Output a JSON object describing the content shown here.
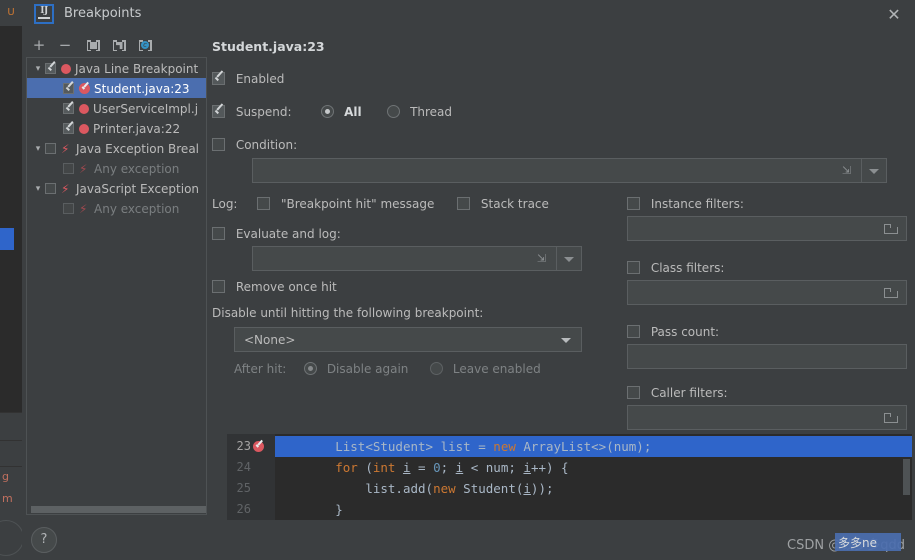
{
  "background": {
    "tab_letter": "U",
    "marker_g": "g",
    "marker_m": "m"
  },
  "window": {
    "title": "Breakpoints",
    "logo_text": "IJ",
    "close_label": "✕"
  },
  "toolbar": {
    "add_label": "+",
    "remove_label": "−",
    "group_icon": "move-to-group-icon",
    "set_icon": "edit-group-icon",
    "mute_icon": "mute-breakpoints-icon"
  },
  "tree": {
    "items": [
      {
        "label": "Java Line Breakpoint",
        "icon": "red-dot-icon",
        "checked": true,
        "expandable": true,
        "depth": 0,
        "selected": false,
        "dim": false
      },
      {
        "label": "Student.java:23",
        "icon": "red-dot-check-icon",
        "checked": true,
        "expandable": false,
        "depth": 1,
        "selected": true,
        "dim": false
      },
      {
        "label": "UserServiceImpl.j",
        "icon": "red-dot-icon",
        "checked": true,
        "expandable": false,
        "depth": 1,
        "selected": false,
        "dim": false
      },
      {
        "label": "Printer.java:22",
        "icon": "red-dot-icon",
        "checked": true,
        "expandable": false,
        "depth": 1,
        "selected": false,
        "dim": false
      },
      {
        "label": "Java Exception Breal",
        "icon": "bolt-icon",
        "checked": false,
        "expandable": true,
        "depth": 0,
        "selected": false,
        "dim": false
      },
      {
        "label": "Any exception",
        "icon": "bolt-dim-icon",
        "checked": false,
        "expandable": false,
        "depth": 1,
        "selected": false,
        "dim": true
      },
      {
        "label": "JavaScript Exception",
        "icon": "bolt-icon",
        "checked": false,
        "expandable": true,
        "depth": 0,
        "selected": false,
        "dim": false
      },
      {
        "label": "Any exception",
        "icon": "bolt-dim-icon",
        "checked": false,
        "expandable": false,
        "depth": 1,
        "selected": false,
        "dim": true
      }
    ]
  },
  "help": {
    "label": "?"
  },
  "detail": {
    "title": "Student.java:23",
    "enabled_label": "Enabled",
    "enabled_checked": true,
    "suspend_label": "Suspend:",
    "suspend_checked": true,
    "suspend_all_label": "All",
    "suspend_thread_label": "Thread",
    "suspend_selected": "All",
    "condition_label": "Condition:",
    "condition_checked": false,
    "condition_value": "",
    "log_label": "Log:",
    "log_hit_message_label": "\"Breakpoint hit\" message",
    "log_hit_message_checked": false,
    "log_stack_trace_label": "Stack trace",
    "log_stack_trace_checked": false,
    "evaluate_and_log_label": "Evaluate and log:",
    "evaluate_and_log_checked": false,
    "evaluate_and_log_value": "",
    "remove_once_hit_label": "Remove once hit",
    "remove_once_hit_checked": false,
    "disable_until_label": "Disable until hitting the following breakpoint:",
    "disable_until_value": "<None>",
    "after_hit_label": "After hit:",
    "after_hit_disable_again_label": "Disable again",
    "after_hit_leave_enabled_label": "Leave enabled",
    "after_hit_selected": "Disable again",
    "instance_filters_label": "Instance filters:",
    "instance_filters_checked": false,
    "instance_filters_value": "",
    "class_filters_label": "Class filters:",
    "class_filters_checked": false,
    "class_filters_value": "",
    "pass_count_label": "Pass count:",
    "pass_count_checked": false,
    "pass_count_value": "",
    "caller_filters_label": "Caller filters:",
    "caller_filters_checked": false,
    "caller_filters_value": ""
  },
  "code_preview": {
    "lines": [
      {
        "number": "23",
        "breakpoint": true,
        "highlight": true,
        "text": "        List<Student> list = new ArrayList<>(num);"
      },
      {
        "number": "24",
        "breakpoint": false,
        "highlight": false,
        "text": "        for (int i = 0; i < num; i++) {"
      },
      {
        "number": "25",
        "breakpoint": false,
        "highlight": false,
        "text": "            list.add(new Student(i));"
      },
      {
        "number": "26",
        "breakpoint": false,
        "highlight": false,
        "text": "        }"
      }
    ]
  },
  "watermark": {
    "text": "CSDN @钱多多qdd",
    "overlay_text": "多多ne"
  },
  "colors": {
    "accent_selection": "#4b6eaf",
    "code_selection": "#2f65ca",
    "breakpoint_red": "#db5860",
    "panel_bg": "#3c3f41",
    "editor_bg": "#2b2b2b",
    "keyword": "#cc7832",
    "number": "#6897bb",
    "string": "#6a8759"
  }
}
